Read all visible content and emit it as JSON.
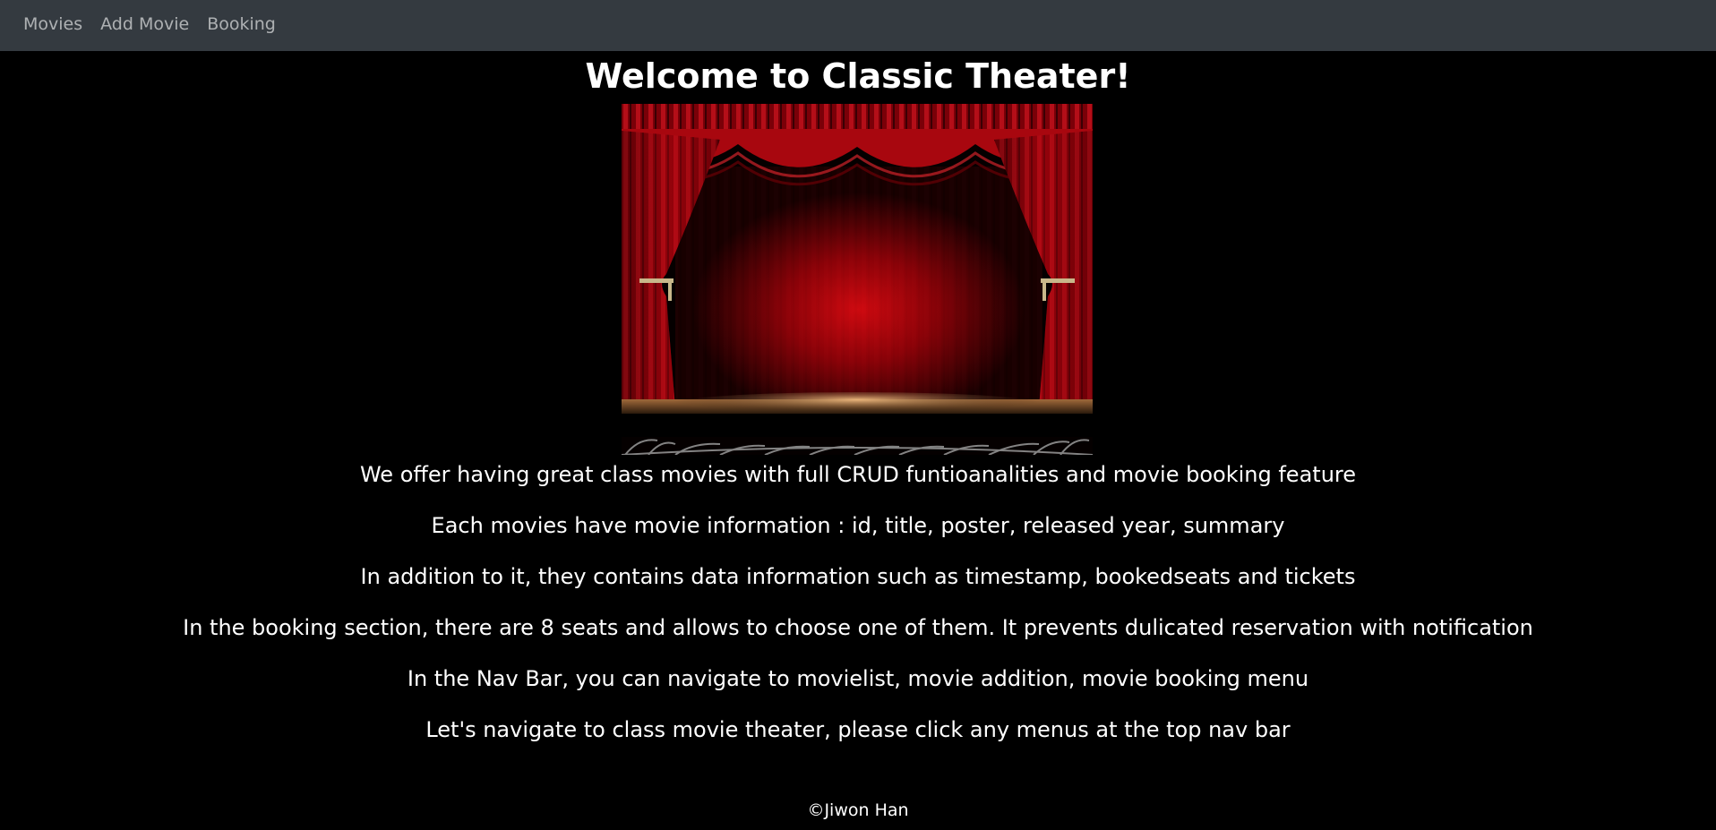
{
  "nav": {
    "items": [
      {
        "label": "Movies"
      },
      {
        "label": "Add Movie"
      },
      {
        "label": "Booking"
      }
    ]
  },
  "main": {
    "title": "Welcome to Classic Theater!",
    "paragraphs": [
      "We offer having great class movies with full CRUD funtioanalities and movie booking feature",
      "Each movies have movie information : id, title, poster, released year, summary",
      "In addition to it, they contains data information such as timestamp, bookedseats and tickets",
      "In the booking section, there are 8 seats and allows to choose one of them. It prevents dulicated reservation with notification",
      "In the Nav Bar, you can navigate to movielist, movie addition, movie booking menu",
      "Let's navigate to class movie theater, please click any menus at the top nav bar"
    ]
  },
  "footer": {
    "text": "©Jiwon Han"
  },
  "colors": {
    "navbar_bg": "#343a40",
    "page_bg": "#000000",
    "curtain_red": "#b3060f"
  }
}
